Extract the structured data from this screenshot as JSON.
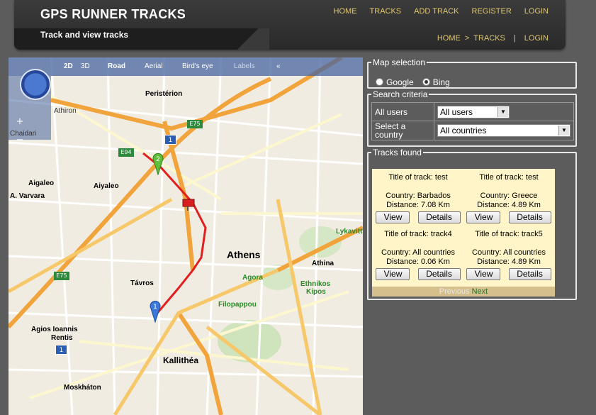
{
  "site": {
    "title": "GPS RUNNER TRACKS",
    "tagline": "Track and view tracks"
  },
  "topnav": [
    "HOME",
    "TRACKS",
    "ADD TRACK",
    "REGISTER",
    "LOGIN"
  ],
  "breadcrumb": {
    "home": "HOME",
    "separator": ">",
    "current": "TRACKS",
    "login": "LOGIN"
  },
  "map": {
    "modes": [
      "2D",
      "3D"
    ],
    "styles": [
      "Road",
      "Aerial",
      "Bird's eye",
      "Labels"
    ],
    "collapse": "«",
    "zoom_in": "+",
    "zoom_out": "−",
    "labels": {
      "athens": "Athens",
      "peristerion": "Peristérion",
      "aiyaleo": "Aiyaleo",
      "aigaleo": "Aigaleo",
      "a_varvara": "A. Varvara",
      "kallithea": "Kallithéa",
      "moskhaton": "Moskháton",
      "agios": "Agios Ioannis",
      "rentis": "Rentis",
      "tavros": "Távros",
      "athina": "Athina",
      "lykavitt": "Lykavitt",
      "agora": "Agora",
      "filopappou": "Filopappou",
      "ethnikos": "Ethnikos",
      "kipos": "Kipos",
      "chaidari": "Chaidari",
      "athiron": "Athiron",
      "e75": "E75",
      "e94": "E94"
    },
    "markers": {
      "start": "1",
      "end": "2"
    },
    "route_color": "#e21f1f"
  },
  "map_selection": {
    "legend": "Map selection",
    "options": [
      "Google",
      "Bing"
    ],
    "selected": "Bing"
  },
  "search": {
    "legend": "Search criteria",
    "rows": [
      {
        "label": "All users",
        "value": "All users"
      },
      {
        "label": "Select a country",
        "value": "All countries"
      }
    ]
  },
  "tracks": {
    "legend": "Tracks found",
    "items": [
      {
        "title": "Title of track: test",
        "country": "Country: Barbados",
        "distance": "Distance: 7.08 Km"
      },
      {
        "title": "Title of track: test",
        "country": "Country: Greece",
        "distance": "Distance: 4.89 Km"
      },
      {
        "title": "Title of track: track4",
        "country": "Country: All countries",
        "distance": "Distance: 0.06 Km"
      },
      {
        "title": "Title of track: track5",
        "country": "Country: All countries",
        "distance": "Distance: 4.89 Km"
      }
    ],
    "view_label": "View",
    "details_label": "Details",
    "previous": "Previous",
    "next": "Next"
  }
}
